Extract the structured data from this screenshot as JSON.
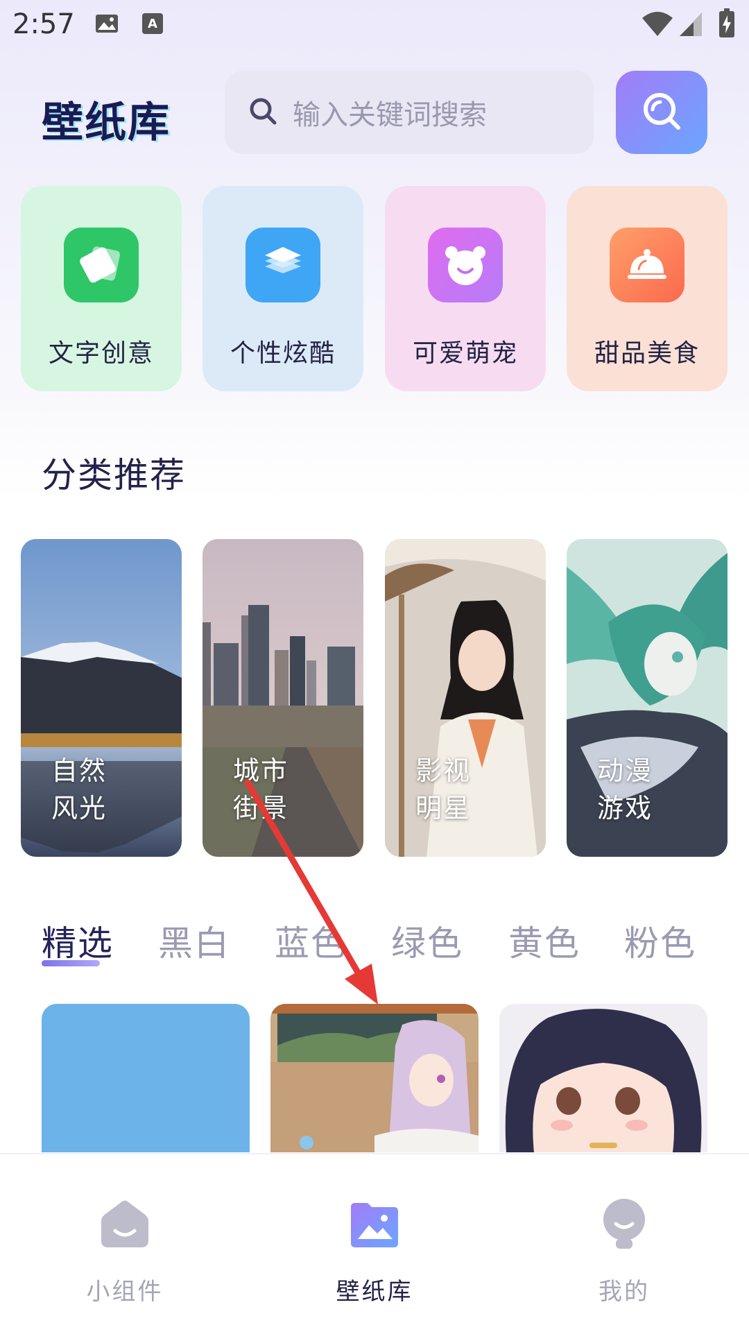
{
  "status_bar": {
    "time": "2:57",
    "icons": [
      "image-icon",
      "keyboard-a-icon",
      "wifi-icon",
      "signal-icon",
      "battery-charging-icon"
    ]
  },
  "header": {
    "logo": "壁纸库",
    "search_placeholder": "输入关键词搜索",
    "search_button_icon": "search-icon"
  },
  "quick_categories": [
    {
      "label": "文字创意",
      "icon": "cards-icon",
      "bg": "#d6f6e1",
      "icon_bg": "#2fc668"
    },
    {
      "label": "个性炫酷",
      "icon": "layers-icon",
      "bg": "#dceaf8",
      "icon_bg": "#3fa6f5"
    },
    {
      "label": "可爱萌宠",
      "icon": "bear-icon",
      "bg": "#f7dcf1",
      "icon_bg": "#d66df2"
    },
    {
      "label": "甜品美食",
      "icon": "cloche-icon",
      "bg": "#fbe0d6",
      "icon_bg": "#fb7d56"
    }
  ],
  "section_title": "分类推荐",
  "categories": [
    {
      "line1": "自然",
      "line2": "风光"
    },
    {
      "line1": "城市",
      "line2": "街景"
    },
    {
      "line1": "影视",
      "line2": "明星"
    },
    {
      "line1": "动漫",
      "line2": "游戏"
    }
  ],
  "color_tabs": [
    "精选",
    "黑白",
    "蓝色",
    "绿色",
    "黄色",
    "粉色"
  ],
  "active_tab": "精选",
  "bottom_nav": [
    {
      "label": "小组件",
      "icon": "home-icon",
      "active": false
    },
    {
      "label": "壁纸库",
      "icon": "gallery-icon",
      "active": true
    },
    {
      "label": "我的",
      "icon": "profile-icon",
      "active": false
    }
  ],
  "colors": {
    "accent": "#7b74e8",
    "annotation_arrow": "#e53935"
  }
}
